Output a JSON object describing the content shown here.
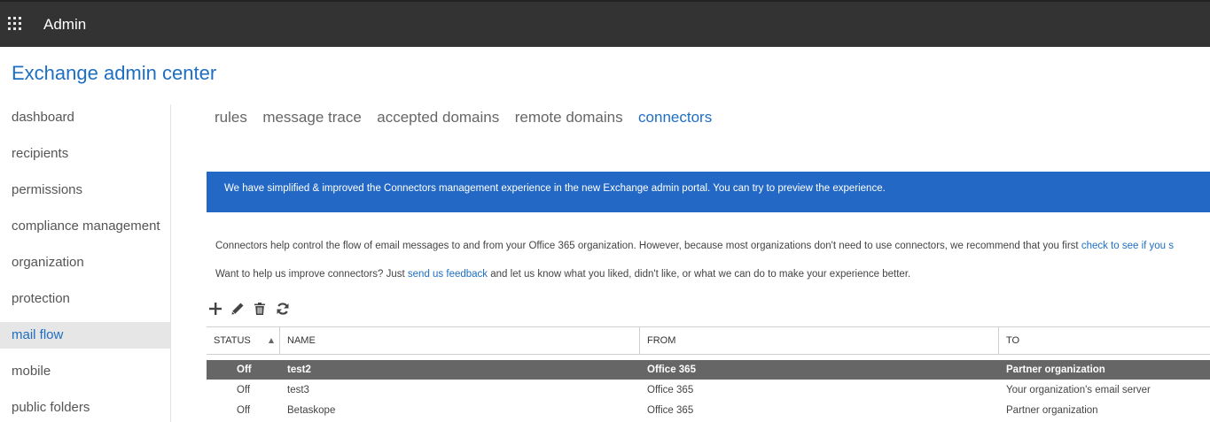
{
  "header": {
    "app_title": "Admin",
    "launcher_icon": "waffle-icon"
  },
  "page_title": "Exchange admin center",
  "nav": {
    "items": [
      {
        "label": "dashboard"
      },
      {
        "label": "recipients"
      },
      {
        "label": "permissions"
      },
      {
        "label": "compliance management"
      },
      {
        "label": "organization"
      },
      {
        "label": "protection"
      },
      {
        "label": "mail flow",
        "selected": true
      },
      {
        "label": "mobile"
      },
      {
        "label": "public folders"
      }
    ]
  },
  "tabs": [
    {
      "label": "rules"
    },
    {
      "label": "message trace"
    },
    {
      "label": "accepted domains"
    },
    {
      "label": "remote domains"
    },
    {
      "label": "connectors",
      "active": true
    }
  ],
  "banner": {
    "text": "We have simplified & improved the Connectors management experience in the new Exchange admin portal. You can try to preview the experience."
  },
  "info": {
    "line1_text": "Connectors help control the flow of email messages to and from your Office 365 organization. However, because most organizations don't need to use connectors, we recommend that you first ",
    "line1_link": "check to see if you s",
    "line2_pre": "Want to help us improve connectors? Just ",
    "line2_link": "send us feedback",
    "line2_post": " and let us know what you liked, didn't like, or what we can do to make your experience better."
  },
  "toolbar": {
    "icons": [
      "add-icon",
      "edit-icon",
      "delete-icon",
      "refresh-icon"
    ]
  },
  "table": {
    "columns": [
      "STATUS",
      "NAME",
      "FROM",
      "TO"
    ],
    "sort": {
      "column": "STATUS",
      "direction": "ascending"
    },
    "rows": [
      {
        "status": "Off",
        "name": "test2",
        "from": "Office 365",
        "to": "Partner organization",
        "selected": true
      },
      {
        "status": "Off",
        "name": "test3",
        "from": "Office 365",
        "to": "Your organization's email server"
      },
      {
        "status": "Off",
        "name": "Betaskope",
        "from": "Office 365",
        "to": "Partner organization"
      }
    ]
  },
  "colors": {
    "accent": "#1e6ec2",
    "banner": "#2368c4",
    "topbar": "#333333",
    "selected_row": "#666666",
    "selected_nav": "#e6e6e6"
  }
}
